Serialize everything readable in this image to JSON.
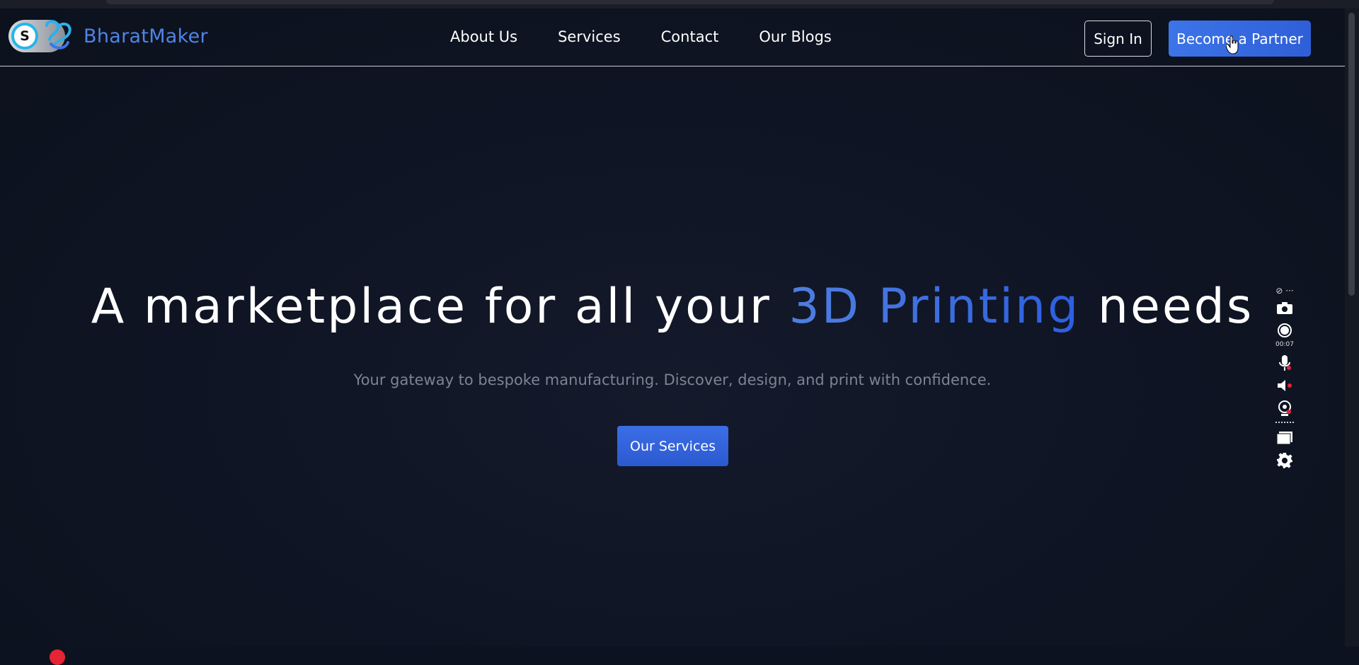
{
  "brand": {
    "name": "BharatMaker",
    "toggle_letter": "S"
  },
  "nav": {
    "items": [
      {
        "label": "About Us"
      },
      {
        "label": "Services"
      },
      {
        "label": "Contact"
      },
      {
        "label": "Our Blogs"
      }
    ]
  },
  "header_actions": {
    "sign_in_label": "Sign In",
    "partner_label": "Become a Partner"
  },
  "hero": {
    "title_before": "A marketplace for all your ",
    "title_accent": "3D Printing",
    "title_after": " needs",
    "subtitle": "Your gateway to bespoke manufacturing. Discover, design, and print with confidence.",
    "cta_label": "Our Services"
  },
  "recorder": {
    "elapsed": "00:07",
    "icons": [
      "link-icon",
      "camera-icon",
      "record-icon",
      "microphone-icon",
      "speaker-icon",
      "webcam-icon",
      "window-icon",
      "gear-icon"
    ]
  },
  "colors": {
    "accent": "#3d74e8",
    "background": "#0d1220",
    "brand_text": "#4f84e6"
  }
}
